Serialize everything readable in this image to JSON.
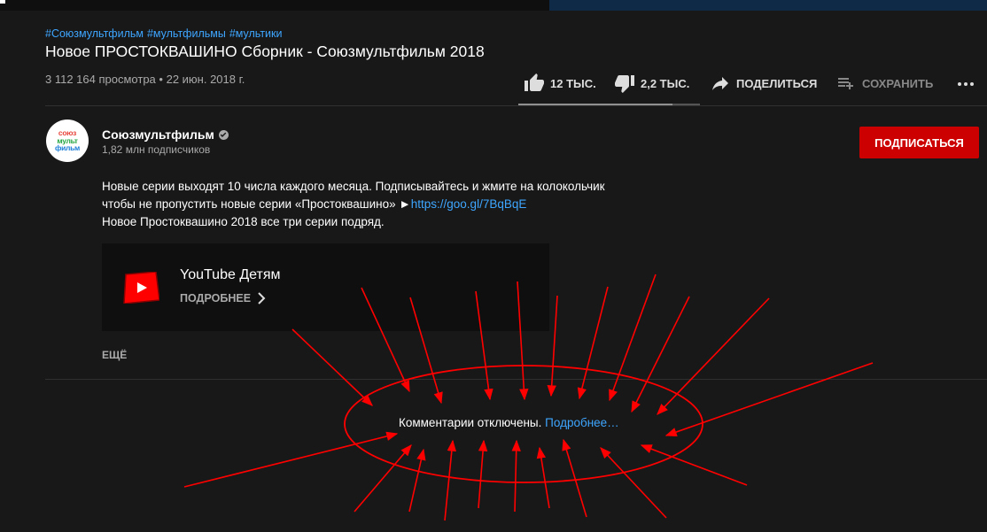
{
  "hashtags": [
    "#Союзмультфильм",
    "#мультфильмы",
    "#мультики"
  ],
  "video": {
    "title": "Новое ПРОСТОКВАШИНО Сборник - Союзмультфильм 2018",
    "views": "3 112 164 просмотра",
    "separator": "•",
    "date": "22 июн. 2018 г."
  },
  "actions": {
    "like_count": "12 ТЫС.",
    "dislike_count": "2,2 ТЫС.",
    "share_label": "ПОДЕЛИТЬСЯ",
    "save_label": "СОХРАНИТЬ",
    "like_ratio": 0.85
  },
  "channel": {
    "logo_lines": [
      "союз",
      "мульт",
      "фильм"
    ],
    "name": "Союзмультфильм",
    "subscribers": "1,82 млн подписчиков",
    "subscribe_label": "ПОДПИСАТЬСЯ"
  },
  "description": {
    "line1": "Новые серии выходят 10 числа каждого месяца. Подписывайтесь и жмите на колокольчик",
    "line2_prefix": "чтобы не пропустить новые серии «Простоквашино»  ►",
    "link": "https://goo.gl/7BqBqE",
    "line3": "Новое Простоквашино 2018 все три серии подряд."
  },
  "card": {
    "title": "YouTube Детям",
    "more_label": "ПОДРОБНЕЕ"
  },
  "show_more_label": "ЕЩЁ",
  "comments": {
    "disabled_text": "Комментарии отключены.",
    "learn_more": "Подробнее…"
  },
  "colors": {
    "background": "#181818",
    "link": "#3ea6ff",
    "subscribe": "#cc0000",
    "annotation": "#ff0000"
  }
}
